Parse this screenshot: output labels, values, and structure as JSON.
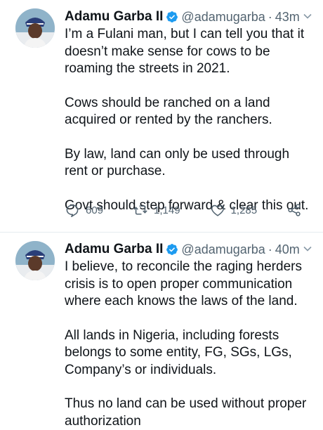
{
  "tweets": [
    {
      "author_name": "Adamu Garba II",
      "handle": "@adamugarba",
      "separator": "·",
      "time": "43m",
      "paragraphs": [
        "I’m a Fulani man, but I can tell you that it doesn’t make sense for cows to be roaming the streets in 2021.",
        "Cows should be ranched on a land acquired or rented by the ranchers.",
        "By law, land can only be used through rent or purchase.",
        "Govt should step forward & clear this out."
      ],
      "replies": "609",
      "retweets": "1,149",
      "likes": "1,285"
    },
    {
      "author_name": "Adamu Garba II",
      "handle": "@adamugarba",
      "separator": "·",
      "time": "40m",
      "paragraphs": [
        "I believe, to reconcile the raging herders crisis is to open proper communication where each knows the laws of the land.",
        "All lands in Nigeria, including forests belongs to some entity, FG, SGs, LGs, Company’s or individuals.",
        "Thus no land can be used without proper authorization"
      ]
    }
  ],
  "icons": {
    "verified": "verified-badge-icon",
    "caret": "chevron-down-icon",
    "reply": "reply-icon",
    "retweet": "retweet-icon",
    "like": "heart-icon",
    "share": "share-icon"
  },
  "colors": {
    "text": "#0f1419",
    "secondary": "#536471",
    "verified": "#1d9bf0",
    "divider": "#e6ecf0"
  }
}
